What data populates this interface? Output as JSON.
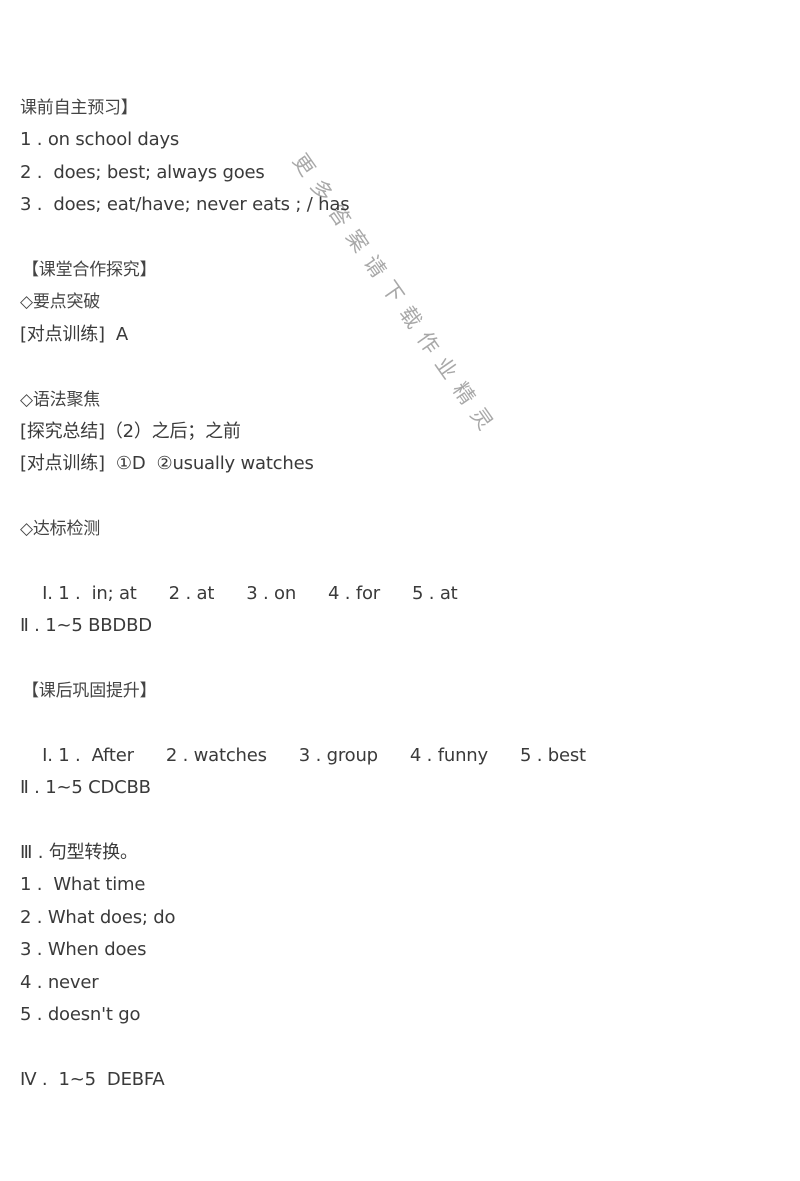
{
  "watermark": "更多答案请下载作业精灵",
  "sections": {
    "preclass": {
      "title": "课前自主预习】",
      "items": [
        "1 . on school days",
        "2 .  does; best; always goes",
        "3 .  does; eat/have; never eats ; / has"
      ]
    },
    "inclass": {
      "title": "【课堂合作探究】",
      "key_points": {
        "title": "◇要点突破",
        "training": "[对点训练]  A"
      },
      "grammar": {
        "title": "◇语法聚焦",
        "summary": "[探究总结]（2）之后；之前",
        "training": "[对点训练]  ①D  ②usually watches"
      },
      "check": {
        "title": "◇达标检测",
        "part1_prefix": "Ⅰ. 1 .  in; at",
        "part1_items": [
          "2 . at",
          "3 . on",
          "4 . for",
          "5 . at"
        ],
        "part2": "Ⅱ . 1~5 BBDBD"
      }
    },
    "afterclass": {
      "title": "【课后巩固提升】",
      "part1_prefix": "Ⅰ. 1 .  After",
      "part1_items": [
        "2 . watches",
        "3 . group",
        "4 . funny",
        "5 . best"
      ],
      "part2": "Ⅱ . 1~5 CDCBB",
      "part3": {
        "title": "Ⅲ . 句型转换。",
        "items": [
          "1 .  What time",
          "2 . What does; do",
          "3 . When does",
          "4 . never",
          "5 . doesn't go"
        ]
      },
      "part4": "Ⅳ .  1~5  DEBFA"
    }
  }
}
